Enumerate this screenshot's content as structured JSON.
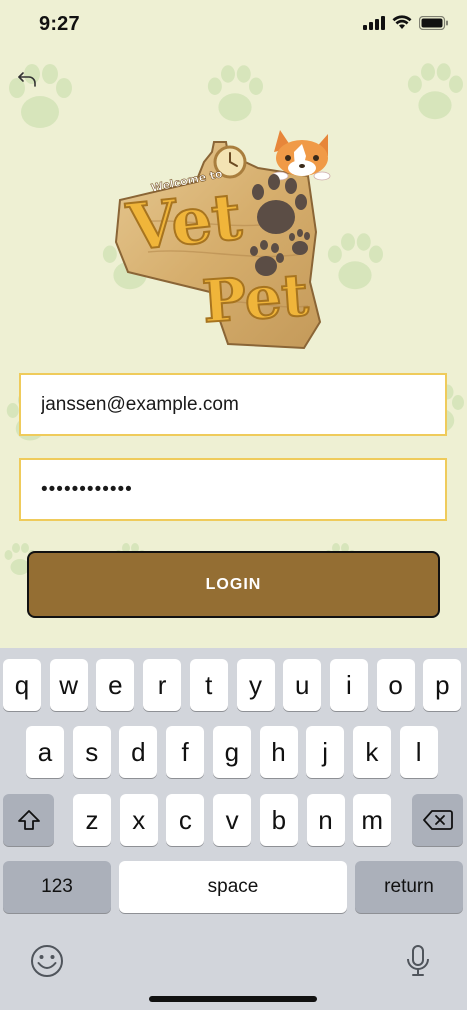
{
  "status_bar": {
    "time": "9:27"
  },
  "logo": {
    "welcome_text": "Welcome to",
    "brand_line1": "Vet",
    "brand_line2": "Pet"
  },
  "login_form": {
    "email_value": "janssen@example.com",
    "password_mask": "••••••••••••",
    "login_label": "LOGIN"
  },
  "keyboard": {
    "row1": [
      "q",
      "w",
      "e",
      "r",
      "t",
      "y",
      "u",
      "i",
      "o",
      "p"
    ],
    "row2": [
      "a",
      "s",
      "d",
      "f",
      "g",
      "h",
      "j",
      "k",
      "l"
    ],
    "row3": [
      "z",
      "x",
      "c",
      "v",
      "b",
      "n",
      "m"
    ],
    "numbers_label": "123",
    "space_label": "space",
    "return_label": "return"
  },
  "colors": {
    "background": "#EEF0D3",
    "field_border": "#EFCB5B",
    "login_button": "#946E33",
    "keyboard": "#D2D5DB"
  }
}
